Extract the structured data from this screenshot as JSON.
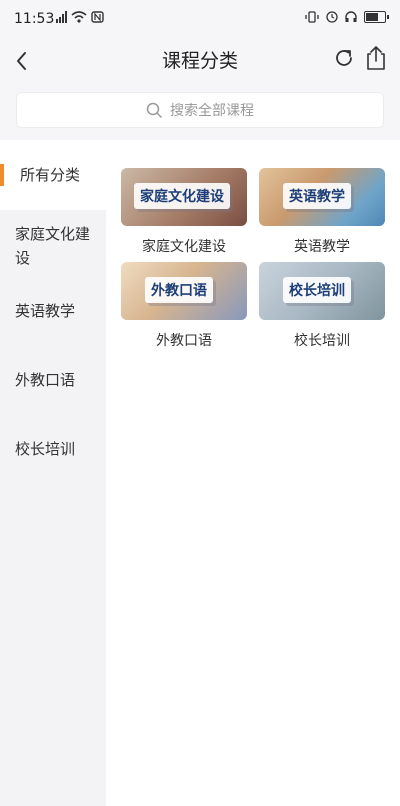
{
  "status": {
    "time": "11:53"
  },
  "nav": {
    "title": "课程分类",
    "back_icon": "chevron-left-icon",
    "refresh_icon": "refresh-icon",
    "share_icon": "share-icon"
  },
  "search": {
    "placeholder": "搜索全部课程"
  },
  "sidebar": {
    "items": [
      {
        "label": "所有分类",
        "active": true
      },
      {
        "label": "家庭文化建设",
        "active": false
      },
      {
        "label": "英语教学",
        "active": false
      },
      {
        "label": "外教口语",
        "active": false
      },
      {
        "label": "校长培训",
        "active": false
      }
    ]
  },
  "courses": [
    {
      "overlay": "家庭文化建设",
      "label": "家庭文化建设",
      "colors": [
        "#c9b8a6",
        "#8d5a4a"
      ]
    },
    {
      "overlay": "英语教学",
      "label": "英语教学",
      "colors": [
        "#d9b48c",
        "#6fa5c9"
      ]
    },
    {
      "overlay": "外教口语",
      "label": "外教口语",
      "colors": [
        "#e8d2b6",
        "#7c8fb5"
      ]
    },
    {
      "overlay": "校长培训",
      "label": "校长培训",
      "colors": [
        "#b9c6d4",
        "#8aa0a8"
      ]
    }
  ],
  "colors": {
    "accent": "#f08c2b",
    "overlay_text": "#1d3e78"
  }
}
